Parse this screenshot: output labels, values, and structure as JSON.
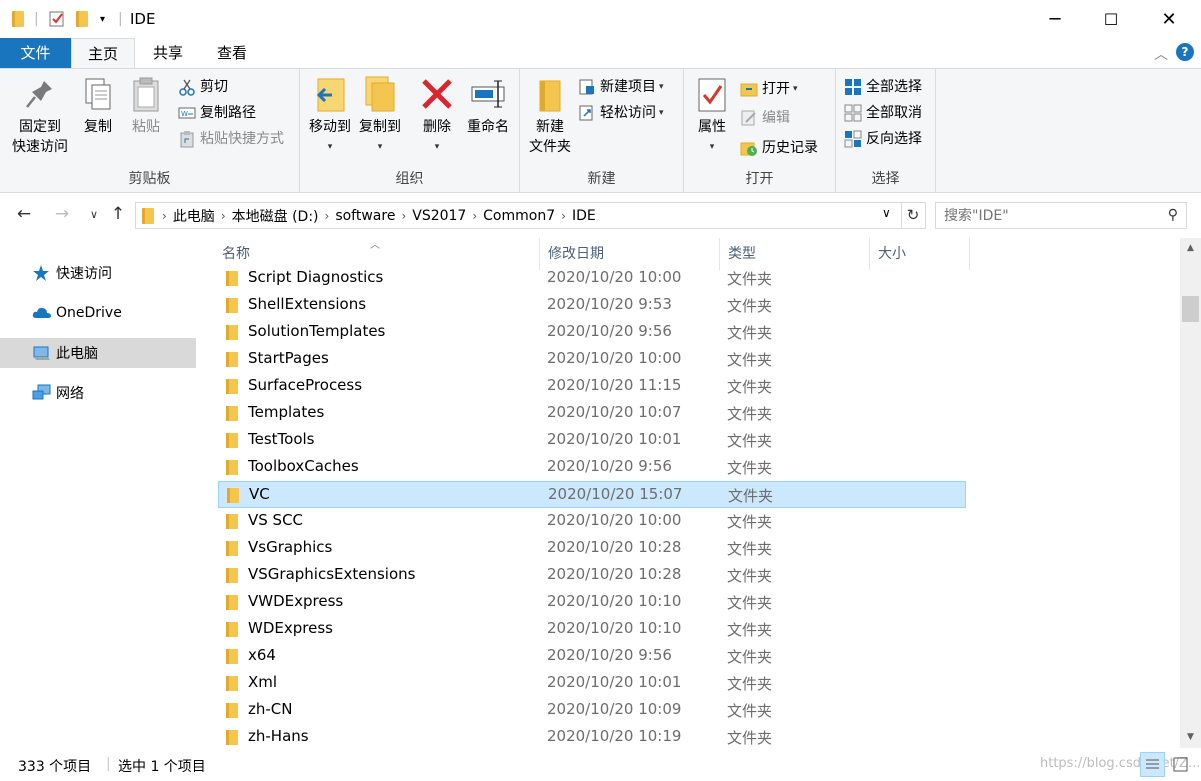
{
  "window": {
    "title": "IDE",
    "controls": {
      "minimize": "─",
      "maximize": "☐",
      "close": "✕"
    }
  },
  "tabs": [
    {
      "label": "文件"
    },
    {
      "label": "主页"
    },
    {
      "label": "共享"
    },
    {
      "label": "查看"
    }
  ],
  "ribbon": {
    "clipboard": {
      "label": "剪贴板",
      "pin": "固定到\n快速访问",
      "pin_line1": "固定到",
      "pin_line2": "快速访问",
      "copy": "复制",
      "paste": "粘贴",
      "cut": "剪切",
      "copy_path": "复制路径",
      "paste_shortcut": "粘贴快捷方式"
    },
    "organize": {
      "label": "组织",
      "move_to": "移动到",
      "copy_to": "复制到",
      "delete": "删除",
      "rename": "重命名"
    },
    "new": {
      "label": "新建",
      "new_folder_line1": "新建",
      "new_folder_line2": "文件夹",
      "new_item": "新建项目",
      "easy_access": "轻松访问"
    },
    "open": {
      "label": "打开",
      "properties": "属性",
      "open": "打开",
      "edit": "编辑",
      "history": "历史记录"
    },
    "select": {
      "label": "选择",
      "select_all": "全部选择",
      "select_none": "全部取消",
      "invert": "反向选择"
    }
  },
  "address": {
    "segments": [
      "此电脑",
      "本地磁盘 (D:)",
      "software",
      "VS2017",
      "Common7",
      "IDE"
    ],
    "search_placeholder": "搜索\"IDE\""
  },
  "nav_pane": [
    {
      "label": "快速访问",
      "icon": "star-icon"
    },
    {
      "label": "OneDrive",
      "icon": "cloud-icon"
    },
    {
      "label": "此电脑",
      "icon": "computer-icon",
      "selected": true
    },
    {
      "label": "网络",
      "icon": "network-icon"
    }
  ],
  "columns": {
    "name": "名称",
    "date": "修改日期",
    "type": "类型",
    "size": "大小"
  },
  "files": [
    {
      "name": "Script Diagnostics",
      "date": "2020/10/20 10:00",
      "type": "文件夹"
    },
    {
      "name": "ShellExtensions",
      "date": "2020/10/20 9:53",
      "type": "文件夹"
    },
    {
      "name": "SolutionTemplates",
      "date": "2020/10/20 9:56",
      "type": "文件夹"
    },
    {
      "name": "StartPages",
      "date": "2020/10/20 10:00",
      "type": "文件夹"
    },
    {
      "name": "SurfaceProcess",
      "date": "2020/10/20 11:15",
      "type": "文件夹"
    },
    {
      "name": "Templates",
      "date": "2020/10/20 10:07",
      "type": "文件夹"
    },
    {
      "name": "TestTools",
      "date": "2020/10/20 10:01",
      "type": "文件夹"
    },
    {
      "name": "ToolboxCaches",
      "date": "2020/10/20 9:56",
      "type": "文件夹"
    },
    {
      "name": "VC",
      "date": "2020/10/20 15:07",
      "type": "文件夹",
      "selected": true
    },
    {
      "name": "VS SCC",
      "date": "2020/10/20 10:00",
      "type": "文件夹"
    },
    {
      "name": "VsGraphics",
      "date": "2020/10/20 10:28",
      "type": "文件夹"
    },
    {
      "name": "VSGraphicsExtensions",
      "date": "2020/10/20 10:28",
      "type": "文件夹"
    },
    {
      "name": "VWDExpress",
      "date": "2020/10/20 10:10",
      "type": "文件夹"
    },
    {
      "name": "WDExpress",
      "date": "2020/10/20 10:10",
      "type": "文件夹"
    },
    {
      "name": "x64",
      "date": "2020/10/20 9:56",
      "type": "文件夹"
    },
    {
      "name": "Xml",
      "date": "2020/10/20 10:01",
      "type": "文件夹"
    },
    {
      "name": "zh-CN",
      "date": "2020/10/20 10:09",
      "type": "文件夹"
    },
    {
      "name": "zh-Hans",
      "date": "2020/10/20 10:19",
      "type": "文件夹"
    }
  ],
  "status": {
    "item_count": "333 个项目",
    "selected_count": "选中 1 个项目",
    "watermark": "https://blog.csdn.net/Z..."
  },
  "colors": {
    "accent": "#1a75bf",
    "selection_bg": "#cce8ff",
    "selection_border": "#99d1ff",
    "folder": "#f3c74f"
  }
}
